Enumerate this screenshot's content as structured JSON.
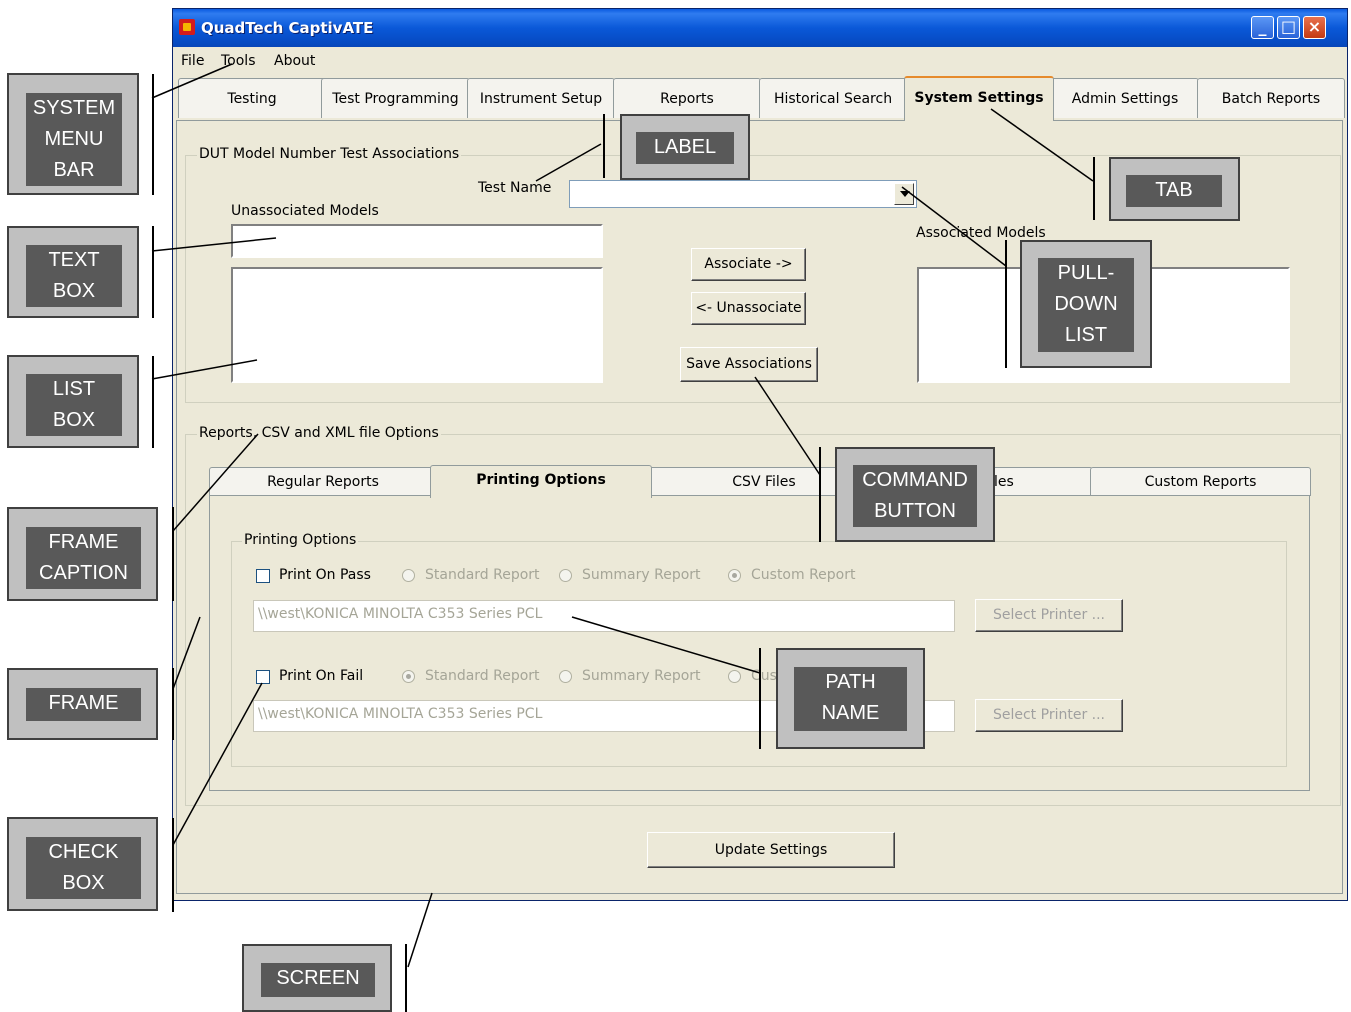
{
  "window": {
    "title": "QuadTech CaptivATE",
    "app_icon": "quadtech-app-icon",
    "controls": [
      "minimize",
      "maximize",
      "close"
    ]
  },
  "menubar": {
    "items": [
      "File",
      "Tools",
      "About"
    ]
  },
  "tabs": [
    {
      "label": "Testing",
      "active": false
    },
    {
      "label": "Test  Programming",
      "active": false
    },
    {
      "label": "Instrument Setup",
      "active": false
    },
    {
      "label": "Reports",
      "active": false
    },
    {
      "label": "Historical  Search",
      "active": false
    },
    {
      "label": "System Settings",
      "active": true
    },
    {
      "label": "Admin Settings",
      "active": false
    },
    {
      "label": "Batch Reports",
      "active": false
    }
  ],
  "dut_frame": {
    "caption": "DUT Model Number Test Associations",
    "test_name_label": "Test Name",
    "test_name_value": "",
    "unassociated_label": "Unassociated Models",
    "associated_label": "Associated Models",
    "associate_button": "Associate ->",
    "unassociate_button": "<- Unassociate",
    "save_button": "Save Associations"
  },
  "reports_frame": {
    "caption": "Reports, CSV and XML file Options",
    "subtabs": [
      {
        "label": "Regular Reports",
        "active": false
      },
      {
        "label": "Printing Options",
        "active": true
      },
      {
        "label": "CSV Files",
        "active": false
      },
      {
        "label": "les",
        "active": false
      },
      {
        "label": "Custom Reports",
        "active": false
      }
    ],
    "printing": {
      "caption": "Printing Options",
      "pass": {
        "label": "Print On Pass",
        "checked": false,
        "options": [
          "Standard Report",
          "Summary Report",
          "Custom Report"
        ],
        "selected": "Custom Report",
        "path": "\\\\west\\KONICA MINOLTA C353 Series PCL",
        "select_printer": "Select Printer ..."
      },
      "fail": {
        "label": "Print On Fail",
        "checked": false,
        "options": [
          "Standard Report",
          "Summary Report",
          "Cus"
        ],
        "selected": "Standard Report",
        "path": "\\\\west\\KONICA MINOLTA C353 Series PCL",
        "select_printer": "Select Printer ..."
      }
    }
  },
  "update_button": "Update Settings",
  "callouts": {
    "system_menu_bar": [
      "SYSTEM",
      "MENU",
      "BAR"
    ],
    "text_box": [
      "TEXT",
      "BOX"
    ],
    "list_box": [
      "LIST",
      "BOX"
    ],
    "frame_caption": [
      "FRAME",
      "CAPTION"
    ],
    "frame": [
      "FRAME"
    ],
    "check_box": [
      "CHECK",
      "BOX"
    ],
    "screen": [
      "SCREEN"
    ],
    "label": [
      "LABEL"
    ],
    "tab": [
      "TAB"
    ],
    "pull_down_list": [
      "PULL-",
      "DOWN",
      "LIST"
    ],
    "command_button": [
      "COMMAND",
      "BUTTON"
    ],
    "path_name": [
      "PATH",
      "NAME"
    ]
  },
  "colors": {
    "titlebar": "#0a58d8",
    "window_bg": "#ece9d8",
    "callout_outer": "#c0c0c0",
    "callout_inner": "#595959",
    "active_tab_accent": "#e68b2c"
  }
}
